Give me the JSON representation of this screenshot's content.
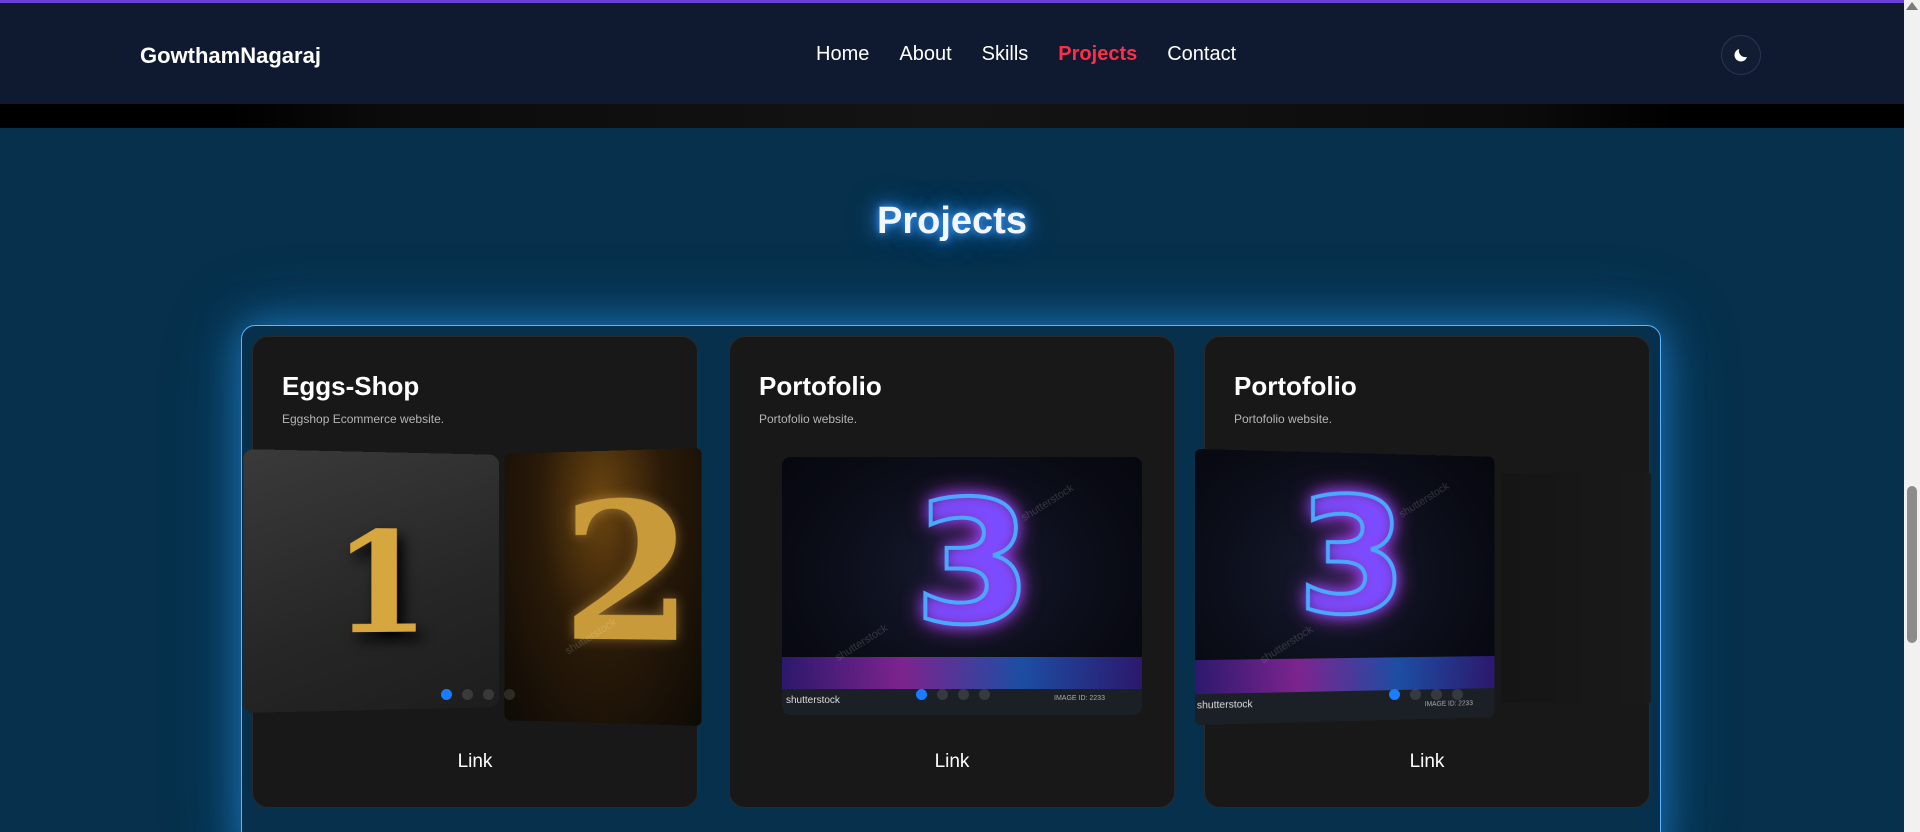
{
  "navbar": {
    "brand": "GowthamNagaraj",
    "links": [
      {
        "label": "Home",
        "active": false
      },
      {
        "label": "About",
        "active": false
      },
      {
        "label": "Skills",
        "active": false
      },
      {
        "label": "Projects",
        "active": true
      },
      {
        "label": "Contact",
        "active": false
      }
    ],
    "theme_icon": "moon-icon"
  },
  "section": {
    "title": "Projects"
  },
  "projects": [
    {
      "title": "Eggs-Shop",
      "description": "Eggshop Ecommerce website.",
      "link_label": "Link",
      "carousel_active_index": 0,
      "carousel_count": 4
    },
    {
      "title": "Portofolio",
      "description": "Portofolio website.",
      "link_label": "Link",
      "carousel_active_index": 0,
      "carousel_count": 4
    },
    {
      "title": "Portofolio",
      "description": "Portofolio website.",
      "link_label": "Link",
      "carousel_active_index": 0,
      "carousel_count": 4
    }
  ],
  "watermarks": {
    "brand_text": "shutterstock",
    "id_text": "IMAGE ID: 2233"
  },
  "colors": {
    "accent": "#ff2d48",
    "glow": "#3d9cff",
    "page_bg": "#06304b",
    "nav_bg": "#0f1a30",
    "card_bg": "#181818"
  }
}
